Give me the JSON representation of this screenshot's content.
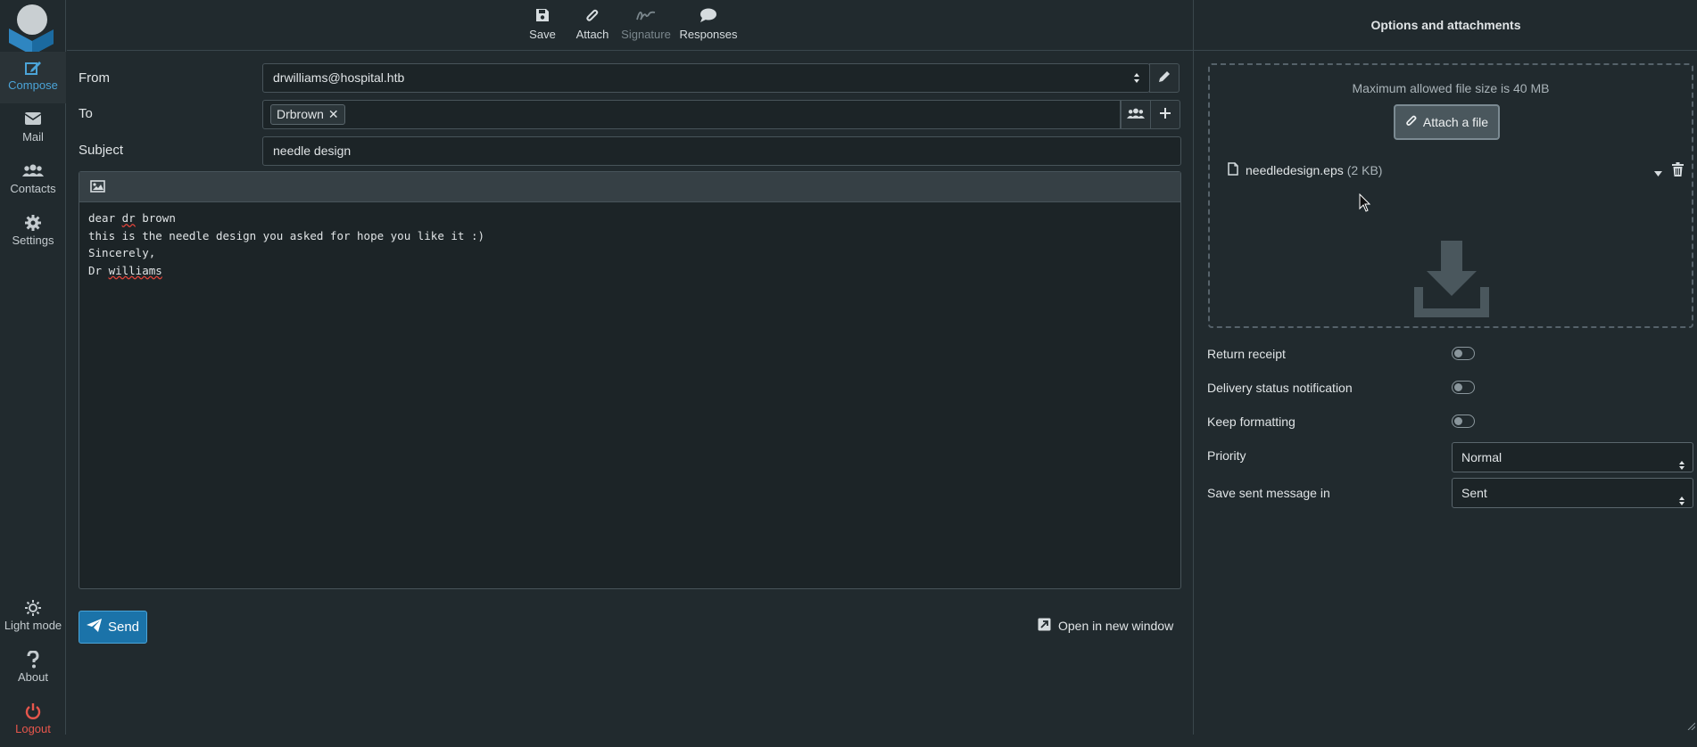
{
  "nav": {
    "items": [
      {
        "label": "Compose",
        "icon": "compose-icon",
        "active": true
      },
      {
        "label": "Mail",
        "icon": "envelope-icon"
      },
      {
        "label": "Contacts",
        "icon": "users-icon"
      },
      {
        "label": "Settings",
        "icon": "gear-icon"
      }
    ],
    "bottom": [
      {
        "label": "Light mode",
        "icon": "sun-icon"
      },
      {
        "label": "About",
        "icon": "question-icon"
      },
      {
        "label": "Logout",
        "icon": "power-icon"
      }
    ]
  },
  "toolbar": {
    "save": "Save",
    "attach": "Attach",
    "signature": "Signature",
    "responses": "Responses"
  },
  "compose": {
    "from_label": "From",
    "from_value": "drwilliams@hospital.htb",
    "to_label": "To",
    "recipient": "Drbrown",
    "subject_label": "Subject",
    "subject_value": "needle design",
    "body": {
      "line1_a": "dear ",
      "line1_b": "dr",
      "line1_c": " brown",
      "line2": "this is the needle design you asked for hope you like it :)",
      "line3": "Sincerely,",
      "line4_a": "Dr ",
      "line4_b": "williams"
    },
    "send_label": "Send",
    "open_new_window": "Open in new window"
  },
  "panel": {
    "title": "Options and attachments",
    "max_size": "Maximum allowed file size is 40 MB",
    "attach_button": "Attach a file",
    "attachment": {
      "name": "needledesign.eps",
      "size": "(2 KB)"
    },
    "options": {
      "return_receipt": "Return receipt",
      "delivery_status": "Delivery status notification",
      "keep_formatting": "Keep formatting",
      "priority_label": "Priority",
      "priority_value": "Normal",
      "save_sent_label": "Save sent message in",
      "save_sent_value": "Sent"
    }
  },
  "colors": {
    "background": "#212a2e",
    "accent": "#4ba4d8",
    "send": "#1b73a9",
    "logout": "#e6564c"
  }
}
